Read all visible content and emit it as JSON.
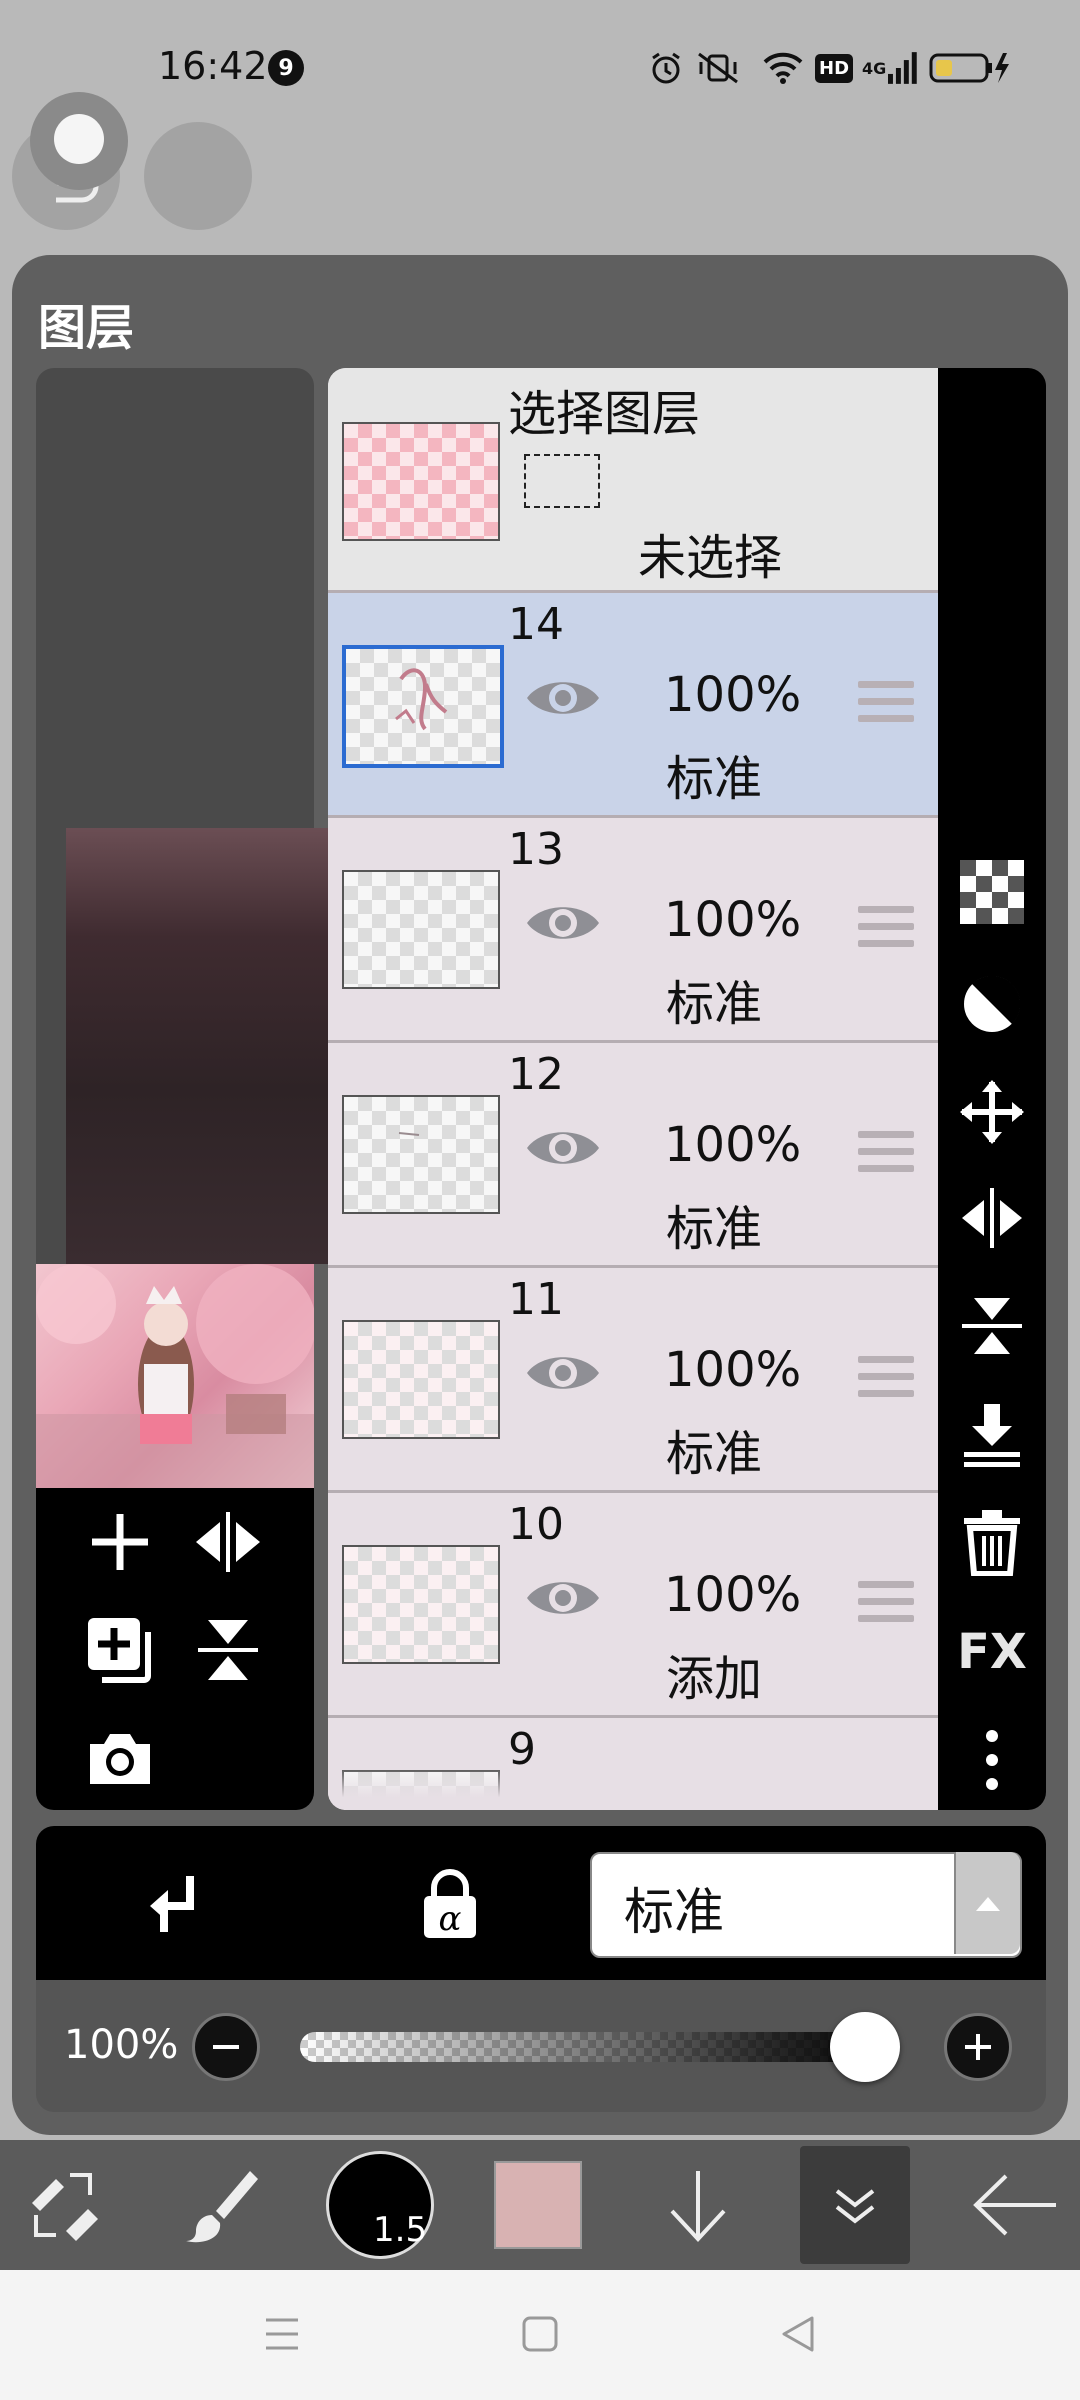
{
  "status_bar": {
    "time": "16:42",
    "notification_count": "9",
    "network_label": "4G",
    "hd_label": "HD"
  },
  "panel": {
    "title": "图层"
  },
  "selection_layer": {
    "title": "选择图层",
    "status": "未选择"
  },
  "layers": [
    {
      "number": "14",
      "opacity": "100%",
      "blend": "标准"
    },
    {
      "number": "13",
      "opacity": "100%",
      "blend": "标准"
    },
    {
      "number": "12",
      "opacity": "100%",
      "blend": "标准"
    },
    {
      "number": "11",
      "opacity": "100%",
      "blend": "标准"
    },
    {
      "number": "10",
      "opacity": "100%",
      "blend": "添加"
    },
    {
      "number": "9",
      "opacity": "",
      "blend": ""
    }
  ],
  "right_toolbar": {
    "fx_label": "FX"
  },
  "layer_settings": {
    "blend_mode": "标准",
    "opacity_label": "100%",
    "opacity_value": 1.0
  },
  "app_toolbar": {
    "brush_size": "1.5",
    "color": "#d8b2b2"
  },
  "colors": {
    "active_layer": "#c9d3e8",
    "active_border": "#2b6bd1"
  }
}
